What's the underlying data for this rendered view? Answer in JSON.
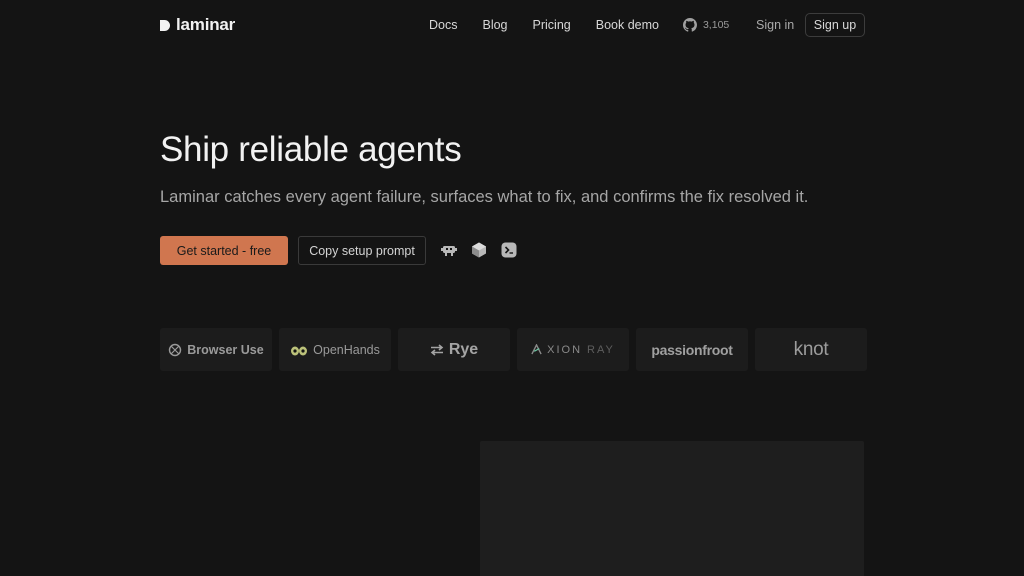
{
  "brand": {
    "name": "laminar"
  },
  "nav": {
    "links": [
      "Docs",
      "Blog",
      "Pricing",
      "Book demo"
    ],
    "github_stars": "3,105",
    "sign_in": "Sign in",
    "sign_up": "Sign up"
  },
  "hero": {
    "title": "Ship reliable agents",
    "subtitle": "Laminar catches every agent failure, surfaces what to fix, and confirms the fix resolved it.",
    "primary_cta": "Get started - free",
    "secondary_cta": "Copy setup prompt",
    "integration_icons": [
      "robot-icon",
      "cube-icon",
      "terminal-icon"
    ]
  },
  "customers": {
    "browser_use": "Browser Use",
    "openhands": "OpenHands",
    "rye": "Rye",
    "axion": "XION",
    "axion_ray": "RAY",
    "passionfroot": "passionfroot",
    "knot": "knot"
  },
  "colors": {
    "background": "#141414",
    "accent": "#d0764f",
    "card": "#1c1c1c"
  }
}
